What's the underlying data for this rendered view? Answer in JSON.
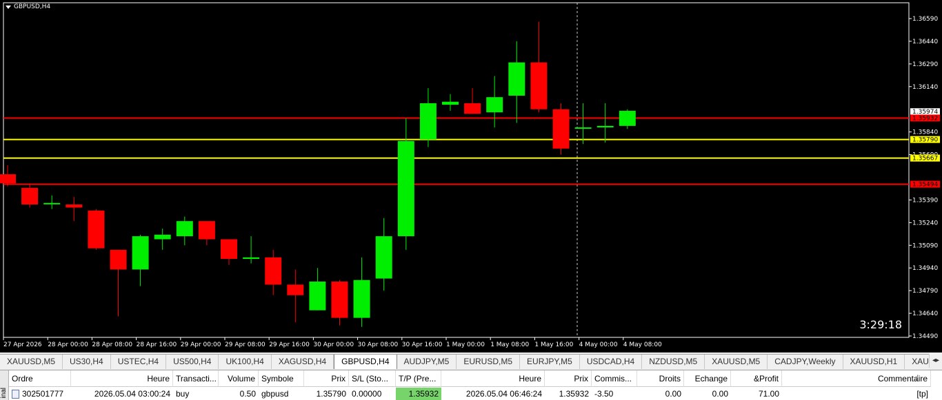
{
  "chart": {
    "symbol_label": "GBPUSD,H4",
    "countdown": "3:29:18",
    "colors": {
      "bull": "#00ee00",
      "bear": "#ff0000",
      "background": "#000000",
      "red_line": "#ff0000",
      "yellow_line": "#ffff00"
    },
    "price_axis_labels": [
      "1.36590",
      "1.36440",
      "1.36290",
      "1.36140",
      "1.35840",
      "1.35690",
      "1.35390",
      "1.35240",
      "1.35090",
      "1.34940",
      "1.34790",
      "1.34640",
      "1.34490"
    ],
    "time_axis_labels": [
      "27 Apr 2026",
      "28 Apr 00:00",
      "28 Apr 08:00",
      "28 Apr 16:00",
      "29 Apr 00:00",
      "29 Apr 08:00",
      "29 Apr 16:00",
      "30 Apr 00:00",
      "30 Apr 08:00",
      "30 Apr 16:00",
      "1 May 00:00",
      "1 May 08:00",
      "1 May 16:00",
      "4 May 00:00",
      "4 May 08:00"
    ],
    "current_price_label": "1.35974",
    "lines": [
      {
        "price": 1.35932,
        "label": "1.35932",
        "color": "red"
      },
      {
        "price": 1.3579,
        "label": "1.35790",
        "color": "yellow"
      },
      {
        "price": 1.35667,
        "label": "1.35667",
        "color": "yellow"
      },
      {
        "price": 1.35494,
        "label": "1.35494",
        "color": "red"
      }
    ]
  },
  "chart_data": {
    "type": "candlestick",
    "title": "GBPUSD,H4",
    "ylim": [
      1.3446,
      1.3663
    ],
    "candles": [
      {
        "o": 1.3556,
        "h": 1.3562,
        "l": 1.3548,
        "c": 1.355
      },
      {
        "o": 1.3547,
        "h": 1.3549,
        "l": 1.3534,
        "c": 1.3536
      },
      {
        "o": 1.3537,
        "h": 1.3542,
        "l": 1.3533,
        "c": 1.3537
      },
      {
        "o": 1.3536,
        "h": 1.3541,
        "l": 1.3525,
        "c": 1.3534
      },
      {
        "o": 1.3532,
        "h": 1.3533,
        "l": 1.3506,
        "c": 1.3507
      },
      {
        "o": 1.3506,
        "h": 1.3504,
        "l": 1.3462,
        "c": 1.3493
      },
      {
        "o": 1.3493,
        "h": 1.3516,
        "l": 1.3482,
        "c": 1.3515
      },
      {
        "o": 1.3513,
        "h": 1.352,
        "l": 1.3506,
        "c": 1.3516
      },
      {
        "o": 1.3515,
        "h": 1.3528,
        "l": 1.3509,
        "c": 1.3525
      },
      {
        "o": 1.3525,
        "h": 1.3525,
        "l": 1.3509,
        "c": 1.3513
      },
      {
        "o": 1.3513,
        "h": 1.3513,
        "l": 1.3496,
        "c": 1.35
      },
      {
        "o": 1.35,
        "h": 1.3515,
        "l": 1.3497,
        "c": 1.3501
      },
      {
        "o": 1.3501,
        "h": 1.3506,
        "l": 1.3476,
        "c": 1.3483
      },
      {
        "o": 1.3483,
        "h": 1.3493,
        "l": 1.3458,
        "c": 1.3476
      },
      {
        "o": 1.3466,
        "h": 1.3494,
        "l": 1.3466,
        "c": 1.3485
      },
      {
        "o": 1.3485,
        "h": 1.3486,
        "l": 1.3456,
        "c": 1.3461
      },
      {
        "o": 1.3461,
        "h": 1.3501,
        "l": 1.3455,
        "c": 1.3486
      },
      {
        "o": 1.3487,
        "h": 1.3527,
        "l": 1.3479,
        "c": 1.3515
      },
      {
        "o": 1.3515,
        "h": 1.3593,
        "l": 1.3506,
        "c": 1.3578
      },
      {
        "o": 1.3579,
        "h": 1.3613,
        "l": 1.3574,
        "c": 1.3603
      },
      {
        "o": 1.3602,
        "h": 1.3609,
        "l": 1.3598,
        "c": 1.3604
      },
      {
        "o": 1.3603,
        "h": 1.3613,
        "l": 1.3596,
        "c": 1.3596
      },
      {
        "o": 1.3597,
        "h": 1.3621,
        "l": 1.3587,
        "c": 1.3607
      },
      {
        "o": 1.3608,
        "h": 1.3644,
        "l": 1.359,
        "c": 1.363
      },
      {
        "o": 1.363,
        "h": 1.3657,
        "l": 1.3597,
        "c": 1.3599
      },
      {
        "o": 1.3599,
        "h": 1.3603,
        "l": 1.3569,
        "c": 1.3573
      },
      {
        "o": 1.3587,
        "h": 1.3603,
        "l": 1.3576,
        "c": 1.3587
      },
      {
        "o": 1.3587,
        "h": 1.3603,
        "l": 1.3577,
        "c": 1.3588
      },
      {
        "o": 1.3588,
        "h": 1.3599,
        "l": 1.3586,
        "c": 1.3598
      }
    ]
  },
  "tabs": [
    {
      "label": "XAUUSD,M5"
    },
    {
      "label": "US30,H4"
    },
    {
      "label": "USTEC,H4"
    },
    {
      "label": "US500,H4"
    },
    {
      "label": "UK100,H4"
    },
    {
      "label": "XAGUSD,H4"
    },
    {
      "label": "GBPUSD,H4",
      "active": true
    },
    {
      "label": "AUDJPY,M5"
    },
    {
      "label": "EURUSD,M5"
    },
    {
      "label": "EURJPY,M5"
    },
    {
      "label": "USDCAD,H4"
    },
    {
      "label": "NZDUSD,M5"
    },
    {
      "label": "XAUUSD,M5"
    },
    {
      "label": "CADJPY,Weekly"
    },
    {
      "label": "XAUUSD,H1"
    },
    {
      "label": "XAUUSD,We"
    }
  ],
  "terminal": {
    "side_label": "inal",
    "columns": [
      "Ordre",
      "Heure",
      "Transacti...",
      "Volume",
      "Symbole",
      "Prix",
      "S/L (Sto...",
      "T/P (Pre...",
      "Heure",
      "Prix",
      "Commis...",
      "Droits",
      "Echange",
      "&Profit",
      "Commentaire"
    ],
    "row": [
      "302501777",
      "2026.05.04 03:00:24",
      "buy",
      "0.50",
      "gbpusd",
      "1.35790",
      "0.00000",
      "1.35932",
      "2026.05.04 06:46:24",
      "1.35932",
      "-3.50",
      "0.00",
      "0.00",
      "71.00",
      "[tp]"
    ],
    "sort_glyph": "/"
  }
}
